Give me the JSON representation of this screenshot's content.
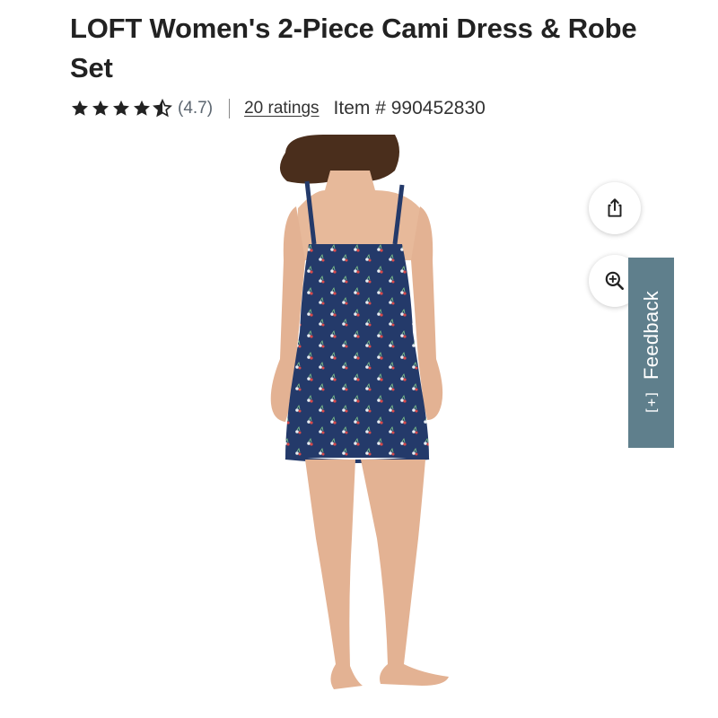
{
  "product": {
    "title": "LOFT Women's 2-Piece Cami Dress & Robe Set",
    "rating_display": "(4.7)",
    "rating": 4.7,
    "star_count": 5,
    "ratings_link": "20 ratings",
    "item_number": "Item # 990452830"
  },
  "icons": {
    "share": "share-icon",
    "zoom": "zoom-in-icon",
    "feedback": "plus-box-icon"
  },
  "feedback": {
    "label": "Feedback",
    "glyph": "[+]"
  },
  "colors": {
    "star": "#222222",
    "feedback_tab": "#5f7f8c",
    "dress": "#243a6a"
  }
}
